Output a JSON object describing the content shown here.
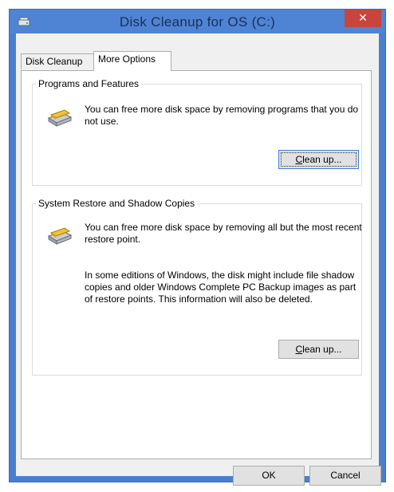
{
  "window": {
    "title": "Disk Cleanup for OS (C:)",
    "close_glyph": "✕"
  },
  "tabs": [
    {
      "label": "Disk Cleanup",
      "active": false
    },
    {
      "label": "More Options",
      "active": true
    }
  ],
  "sections": [
    {
      "title": "Programs and Features",
      "icon": "programs-drive-icon",
      "paragraphs": [
        "You can free more disk space by removing programs that you do not use."
      ],
      "button": {
        "mnemonic": "C",
        "rest": "lean up...",
        "focused": true
      }
    },
    {
      "title": "System Restore and Shadow Copies",
      "icon": "restore-drive-icon",
      "paragraphs": [
        "You can free more disk space by removing all but the most recent restore point.",
        "In some editions of Windows, the disk might include file shadow copies and older Windows Complete PC Backup images as part of restore points. This information will also be deleted."
      ],
      "button": {
        "mnemonic": "C",
        "rest": "lean up...",
        "focused": false
      }
    }
  ],
  "footer": {
    "ok_label": "OK",
    "cancel_label": "Cancel"
  },
  "colors": {
    "titlebar": "#4f84d4",
    "close_button": "#c7453c",
    "client": "#f0f0f0"
  }
}
